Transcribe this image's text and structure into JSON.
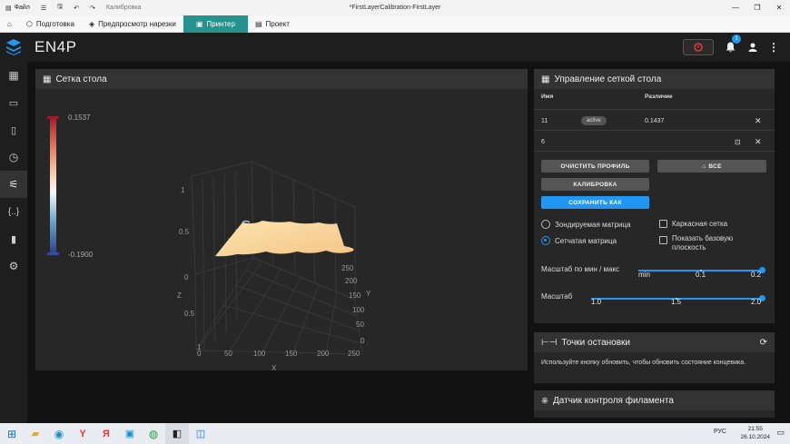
{
  "titlebar": {
    "file": "Файл",
    "doc": "Калибровка",
    "title": "*FirstLayerCalibration-FirstLayer"
  },
  "tabs": [
    {
      "label": "Подготовка"
    },
    {
      "label": "Предпросмотр нарезки"
    },
    {
      "label": "Принтер"
    },
    {
      "label": "Проект"
    }
  ],
  "app": {
    "brand": "EN4P",
    "notifications": "1"
  },
  "bed": {
    "title": "Сетка стола",
    "scale_max": "0.1537",
    "scale_min": "-0.1900",
    "z_ticks": [
      "1",
      "0.5",
      "0",
      "0.5",
      "1"
    ],
    "x_ticks": [
      "0",
      "50",
      "100",
      "150",
      "200",
      "250"
    ],
    "y_ticks": [
      "250",
      "200",
      "150",
      "100",
      "50",
      "0"
    ],
    "x_label": "X",
    "y_label": "Y",
    "z_label": "Z"
  },
  "mesh": {
    "title": "Управление сеткой стола",
    "col_name": "Имя",
    "col_diff": "Различие",
    "profiles": [
      {
        "name": "11",
        "status": "active",
        "diff": "0.1437"
      },
      {
        "name": "6"
      }
    ],
    "clear_profile": "ОЧИСТИТЬ ПРОФИЛЬ",
    "home_all": "ВСЕ",
    "calibrate": "КАЛИБРОВКА",
    "save_as": "СОХРАНИТЬ КАК",
    "probed": "Зондируемая матрица",
    "meshed": "Сетчатая матрица",
    "wireframe": "Каркасная сетка",
    "show_base": "Показать базовую плоскость",
    "minmax_label": "Масштаб по мин / макс",
    "minmax_ticks": [
      "min",
      "0.1",
      "0.2"
    ],
    "scale_label": "Масштаб",
    "scale_ticks": [
      "1.0",
      "1.5",
      "2.0"
    ],
    "minmax_value": "0.2",
    "scale_value": "2.0"
  },
  "stops": {
    "title": "Точки остановки",
    "hint": "Используйте кнопку обновить, чтобы обновить состояние концевика."
  },
  "filament": {
    "title": "Датчик контроля филамента"
  },
  "taskbar": {
    "time": "21:55",
    "date": "26.10.2024",
    "lang": "РУС"
  },
  "colors": {
    "accent": "#2196f3",
    "tab_active": "#27938f"
  }
}
